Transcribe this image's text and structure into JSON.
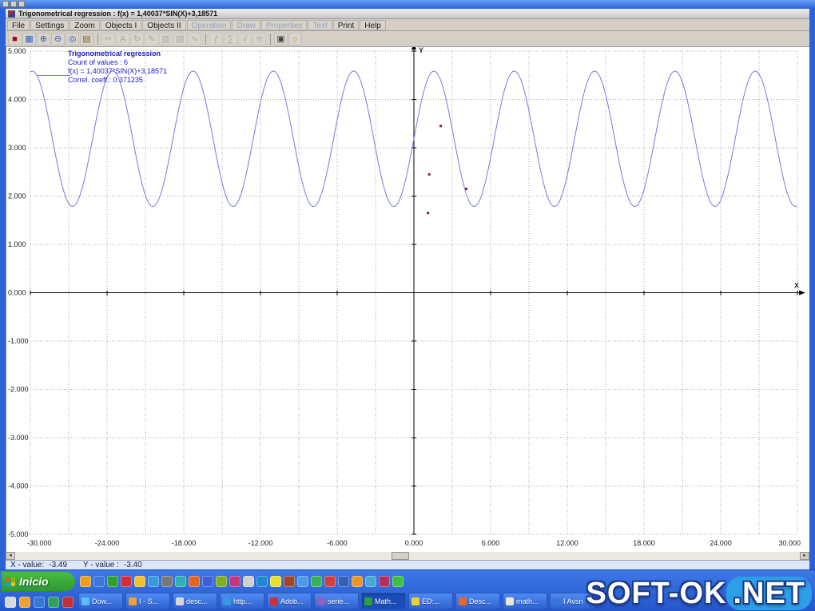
{
  "window": {
    "title": "Trigonometrical regression : f(x) = 1,40037*SIN(X)+3,18571"
  },
  "menu": {
    "items": [
      {
        "label": "File",
        "enabled": true
      },
      {
        "label": "Settings",
        "enabled": true
      },
      {
        "label": "Zoom",
        "enabled": true
      },
      {
        "label": "Objects I",
        "enabled": true
      },
      {
        "label": "Objects II",
        "enabled": true
      },
      {
        "label": "Operation",
        "enabled": false
      },
      {
        "label": "Draw",
        "enabled": false
      },
      {
        "label": "Properties",
        "enabled": false
      },
      {
        "label": "Text",
        "enabled": false
      },
      {
        "label": "Print",
        "enabled": true
      },
      {
        "label": "Help",
        "enabled": true
      }
    ]
  },
  "toolbar": {
    "icons": [
      {
        "name": "record-icon",
        "glyph": "■",
        "color": "#b00000",
        "enabled": true
      },
      {
        "name": "chart-icon",
        "glyph": "▦",
        "color": "#3060c0",
        "enabled": true
      },
      {
        "name": "zoom-in-icon",
        "glyph": "⊕",
        "color": "#3060c0",
        "enabled": true
      },
      {
        "name": "zoom-out-icon",
        "glyph": "⊖",
        "color": "#3060c0",
        "enabled": true
      },
      {
        "name": "zoom-window-icon",
        "glyph": "◎",
        "color": "#3060c0",
        "enabled": true
      },
      {
        "name": "options-icon",
        "glyph": "▤",
        "color": "#806030",
        "enabled": true
      },
      {
        "sep": true
      },
      {
        "name": "cut-icon",
        "glyph": "✂",
        "enabled": false
      },
      {
        "name": "text-icon",
        "glyph": "A",
        "enabled": false
      },
      {
        "name": "refresh-icon",
        "glyph": "↻",
        "enabled": false
      },
      {
        "name": "pencil-icon",
        "glyph": "✎",
        "enabled": false
      },
      {
        "name": "grid-icon",
        "glyph": "▥",
        "enabled": false
      },
      {
        "name": "bar-chart-icon",
        "glyph": "▧",
        "enabled": false
      },
      {
        "name": "line-chart-icon",
        "glyph": "∿",
        "enabled": false
      },
      {
        "sep": true
      },
      {
        "name": "function-icon",
        "glyph": "ƒ",
        "enabled": false
      },
      {
        "name": "sum-icon",
        "glyph": "∑",
        "enabled": false
      },
      {
        "name": "sqrt-icon",
        "glyph": "√",
        "enabled": false
      },
      {
        "name": "pi-icon",
        "glyph": "π",
        "enabled": false
      },
      {
        "sep": true
      },
      {
        "name": "print-icon",
        "glyph": "▣",
        "color": "#404040",
        "enabled": true
      },
      {
        "name": "hint-icon",
        "glyph": "☼",
        "color": "#d8a000",
        "enabled": true
      }
    ]
  },
  "legend": {
    "line1": "Trigonometrical regression",
    "line2": "Count of values : 6",
    "line3": "f(x) = 1,40037*SIN(X)+3,18571",
    "line4": "Correl. coeff.:  0.371235"
  },
  "chart_data": {
    "type": "line",
    "title": "Trigonometrical regression",
    "function": "f(x) = 1.40037*SIN(X)+3.18571",
    "amplitude": 1.40037,
    "offset": 3.18571,
    "x_range": [
      -30,
      30
    ],
    "y_range": [
      -5,
      5
    ],
    "x_tick_step": 6,
    "x_grid_step": 3,
    "y_tick_step": 1,
    "x_tick_labels": [
      "-30.000",
      "-24.000",
      "-18.000",
      "-12.000",
      "-6.000",
      "0.000",
      "6.000",
      "12.000",
      "18.000",
      "24.000",
      "30.000"
    ],
    "y_tick_labels": [
      "5.000",
      "4.000",
      "3.000",
      "2.000",
      "1.000",
      "0.000",
      "-1.000",
      "-2.000",
      "-3.000",
      "-4.000",
      "-5.000"
    ],
    "axis_labels": {
      "x": "X",
      "y": "Y"
    },
    "grid": true,
    "curve_color": "#7878e8",
    "point_color": "#8b2020",
    "points": [
      {
        "x": 2.1,
        "y": 3.45
      },
      {
        "x": 1.2,
        "y": 2.45
      },
      {
        "x": 4.1,
        "y": 2.15
      },
      {
        "x": 1.1,
        "y": 1.65
      }
    ]
  },
  "scrollbar": {
    "left_glyph": "◄",
    "right_glyph": "►"
  },
  "status": {
    "x_label": "X - value:",
    "x_value": "-3.49",
    "y_label": "Y - value :",
    "y_value": "-3.40"
  },
  "taskbar": {
    "start_label": "Inicio",
    "flag_colors": [
      "#f35325",
      "#81bc06",
      "#05a6f0",
      "#ffba08"
    ],
    "quick_launch_colors": [
      "#e8a020",
      "#3c78dc",
      "#30a030",
      "#d03030",
      "#f0c030",
      "#3898e0",
      "#787878",
      "#30b0b0",
      "#e06820",
      "#4060d0",
      "#80b020",
      "#c03880",
      "#d0d0d0",
      "#2088d0",
      "#e8e030",
      "#a04828",
      "#5098e8",
      "#38b058",
      "#d04040",
      "#3060b8",
      "#e89828",
      "#48a8d8",
      "#b03060",
      "#40c040"
    ],
    "quick_launch_row2_colors": [
      "#d8d8d8",
      "#f0a030",
      "#3878d8",
      "#30a060",
      "#c03030"
    ],
    "buttons": [
      {
        "label": "Dow...",
        "icon_color": "#58c0f0",
        "active": false
      },
      {
        "label": "I - S...",
        "icon_color": "#f0a030",
        "active": false
      },
      {
        "label": "desc...",
        "icon_color": "#d8d8d8",
        "active": false
      },
      {
        "label": "http...",
        "icon_color": "#3898e0",
        "active": false
      },
      {
        "label": "Adob...",
        "icon_color": "#d03030",
        "active": false
      },
      {
        "label": "serie...",
        "icon_color": "#9060c0",
        "active": false
      },
      {
        "label": "Math...",
        "icon_color": "#30a030",
        "active": true
      },
      {
        "label": "ED:...",
        "icon_color": "#f0d030",
        "active": false
      },
      {
        "label": "Desc...",
        "icon_color": "#e86820",
        "active": false
      },
      {
        "label": "math...",
        "icon_color": "#f0e8d0",
        "active": false
      },
      {
        "label": "I Avsn",
        "icon_color": "#3878d8",
        "active": false
      }
    ]
  },
  "watermark": {
    "part1": "SOFT-",
    "part2": "OK",
    "part3": ".NET"
  }
}
